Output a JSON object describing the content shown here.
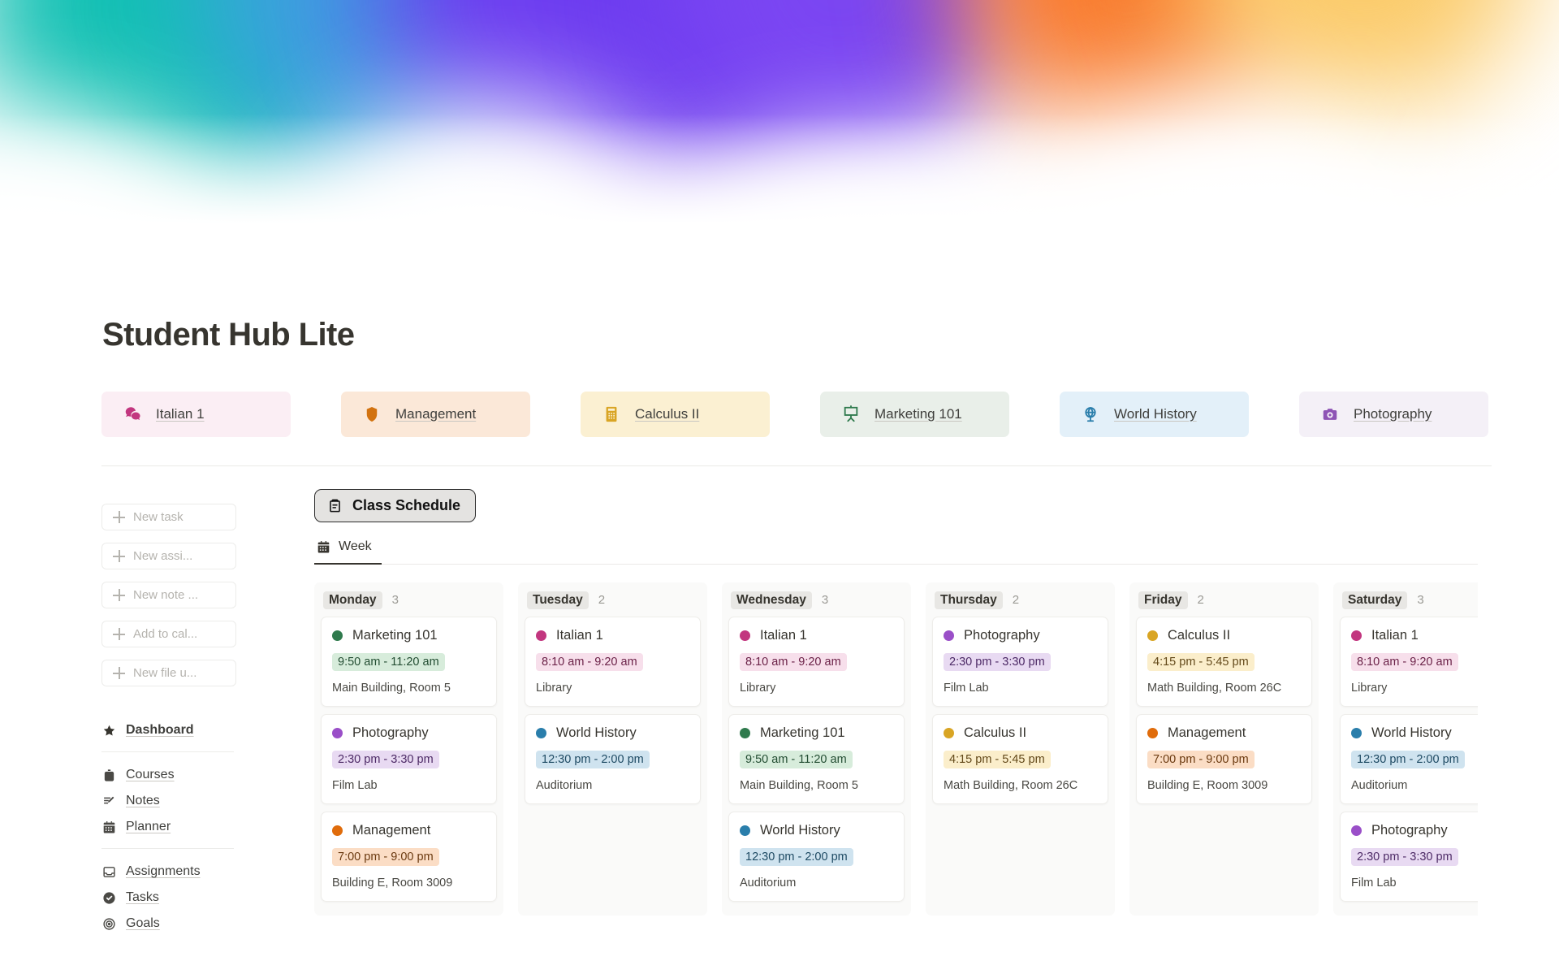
{
  "banner": {
    "name": "gradient-banner"
  },
  "page": {
    "title": "Student Hub Lite"
  },
  "course_chips": [
    {
      "label": "Italian 1",
      "icon": "translate-icon",
      "bg": "#fbeef4",
      "icon_color": "#c2367f"
    },
    {
      "label": "Management",
      "icon": "shield-icon",
      "bg": "#fbe8d8",
      "icon_color": "#d2720f"
    },
    {
      "label": "Calculus II",
      "icon": "calculator-icon",
      "bg": "#fbf0d2",
      "icon_color": "#d9a524"
    },
    {
      "label": "Marketing 101",
      "icon": "easel-icon",
      "bg": "#e9efe9",
      "icon_color": "#2f7a4d"
    },
    {
      "label": "World History",
      "icon": "globe-icon",
      "bg": "#e3f0f9",
      "icon_color": "#2a7eab"
    },
    {
      "label": "Photography",
      "icon": "camera-icon",
      "bg": "#f4f0f7",
      "icon_color": "#8e54b5"
    }
  ],
  "sidebar": {
    "quick_actions": [
      {
        "label": "New task",
        "icon": "plus-icon"
      },
      {
        "label": "New assi...",
        "icon": "plus-icon"
      },
      {
        "label": "New note ...",
        "icon": "plus-icon"
      },
      {
        "label": "Add to cal...",
        "icon": "plus-icon"
      },
      {
        "label": "New file u...",
        "icon": "plus-icon"
      }
    ],
    "nav_groups": [
      [
        {
          "label": "Dashboard",
          "icon": "star-icon",
          "bold": true
        }
      ],
      [
        {
          "label": "Courses",
          "icon": "backpack-icon",
          "bold": false
        },
        {
          "label": "Notes",
          "icon": "note-pencil-icon",
          "bold": false
        },
        {
          "label": "Planner",
          "icon": "calendar-icon",
          "bold": false
        }
      ],
      [
        {
          "label": "Assignments",
          "icon": "inbox-icon",
          "bold": false
        },
        {
          "label": "Tasks",
          "icon": "check-circle-icon",
          "bold": false
        },
        {
          "label": "Goals",
          "icon": "target-icon",
          "bold": false
        }
      ]
    ]
  },
  "main": {
    "schedule_button": {
      "label": "Class Schedule",
      "icon": "clipboard-icon"
    },
    "tabs": [
      {
        "label": "Week",
        "icon": "calendar-icon",
        "active": true
      }
    ]
  },
  "schedule": {
    "days": [
      {
        "name": "Monday",
        "count": "3",
        "events": [
          {
            "title": "Marketing 101",
            "time": "9:50 am - 11:20 am",
            "location": "Main Building, Room 5",
            "dot": "#2f7a4d",
            "time_bg": "#d7ecdb",
            "time_fg": "#234d32"
          },
          {
            "title": "Photography",
            "time": "2:30 pm - 3:30 pm",
            "location": "Film Lab",
            "dot": "#9a4fc8",
            "time_bg": "#e8daf2",
            "time_fg": "#4d2a66"
          },
          {
            "title": "Management",
            "time": "7:00 pm - 9:00 pm",
            "location": "Building E, Room 3009",
            "dot": "#e06c0b",
            "time_bg": "#fbddc5",
            "time_fg": "#6b3a10"
          }
        ]
      },
      {
        "name": "Tuesday",
        "count": "2",
        "events": [
          {
            "title": "Italian 1",
            "time": "8:10 am - 9:20 am",
            "location": "Library",
            "dot": "#c2367f",
            "time_bg": "#f7dfeb",
            "time_fg": "#6b2248"
          },
          {
            "title": "World History",
            "time": "12:30 pm - 2:00 pm",
            "location": "Auditorium",
            "dot": "#2a7eab",
            "time_bg": "#cfe3ef",
            "time_fg": "#1e4a63"
          }
        ]
      },
      {
        "name": "Wednesday",
        "count": "3",
        "events": [
          {
            "title": "Italian 1",
            "time": "8:10 am - 9:20 am",
            "location": "Library",
            "dot": "#c2367f",
            "time_bg": "#f7dfeb",
            "time_fg": "#6b2248"
          },
          {
            "title": "Marketing 101",
            "time": "9:50 am - 11:20 am",
            "location": "Main Building, Room 5",
            "dot": "#2f7a4d",
            "time_bg": "#d7ecdb",
            "time_fg": "#234d32"
          },
          {
            "title": "World History",
            "time": "12:30 pm - 2:00 pm",
            "location": "Auditorium",
            "dot": "#2a7eab",
            "time_bg": "#cfe3ef",
            "time_fg": "#1e4a63"
          }
        ]
      },
      {
        "name": "Thursday",
        "count": "2",
        "events": [
          {
            "title": "Photography",
            "time": "2:30 pm - 3:30 pm",
            "location": "Film Lab",
            "dot": "#9a4fc8",
            "time_bg": "#e8daf2",
            "time_fg": "#4d2a66"
          },
          {
            "title": "Calculus II",
            "time": "4:15 pm - 5:45 pm",
            "location": "Math Building, Room 26C",
            "dot": "#d9a524",
            "time_bg": "#fbeecb",
            "time_fg": "#63491a"
          }
        ]
      },
      {
        "name": "Friday",
        "count": "2",
        "events": [
          {
            "title": "Calculus II",
            "time": "4:15 pm - 5:45 pm",
            "location": "Math Building, Room 26C",
            "dot": "#d9a524",
            "time_bg": "#fbeecb",
            "time_fg": "#63491a"
          },
          {
            "title": "Management",
            "time": "7:00 pm - 9:00 pm",
            "location": "Building E, Room 3009",
            "dot": "#e06c0b",
            "time_bg": "#fbddc5",
            "time_fg": "#6b3a10"
          }
        ]
      },
      {
        "name": "Saturday",
        "count": "3",
        "events": [
          {
            "title": "Italian 1",
            "time": "8:10 am - 9:20 am",
            "location": "Library",
            "dot": "#c2367f",
            "time_bg": "#f7dfeb",
            "time_fg": "#6b2248"
          },
          {
            "title": "World History",
            "time": "12:30 pm - 2:00 pm",
            "location": "Auditorium",
            "dot": "#2a7eab",
            "time_bg": "#cfe3ef",
            "time_fg": "#1e4a63"
          },
          {
            "title": "Photography",
            "time": "2:30 pm - 3:30 pm",
            "location": "Film Lab",
            "dot": "#9a4fc8",
            "time_bg": "#e8daf2",
            "time_fg": "#4d2a66"
          }
        ]
      }
    ]
  }
}
